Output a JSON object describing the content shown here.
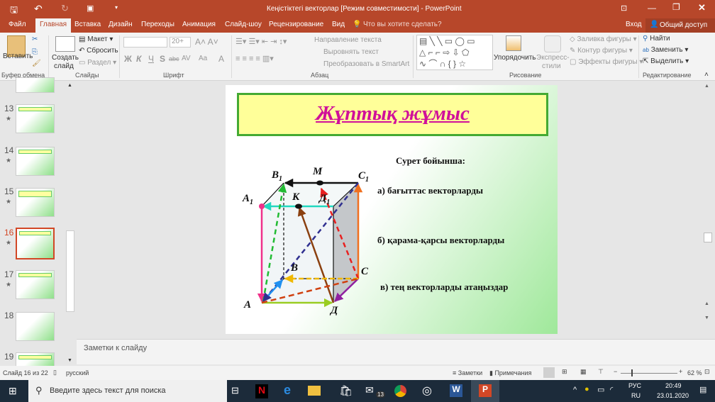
{
  "titlebar": {
    "title": "Кеңістіктегі векторлар [Режим совместимости] - PowerPoint",
    "signin": "Вход",
    "share": "Общий доступ"
  },
  "tabs": [
    "Файл",
    "Главная",
    "Вставка",
    "Дизайн",
    "Переходы",
    "Анимация",
    "Слайд-шоу",
    "Рецензирование",
    "Вид"
  ],
  "tell_me": "Что вы хотите сделать?",
  "ribbon": {
    "paste": "Вставить",
    "clipboard": "Буфер обмена",
    "new_slide_1": "Создать",
    "new_slide_2": "слайд",
    "layout": "Макет",
    "reset": "Сбросить",
    "section": "Раздел",
    "slides": "Слайды",
    "font_size": "20+",
    "font": "Шрифт",
    "bold": "Ж",
    "italic": "К",
    "underline": "Ч",
    "shadow": "S",
    "strike": "abc",
    "spacing": "AV",
    "case": "Aa",
    "font_color": "A",
    "text_dir": "Направление текста",
    "align_text": "Выровнять текст",
    "smartart": "Преобразовать в SmartArt",
    "paragraph": "Абзац",
    "arrange": "Упорядочить",
    "quick_styles_1": "Экспресс-",
    "quick_styles_2": "стили",
    "fill": "Заливка фигуры",
    "outline": "Контур фигуры",
    "effects": "Эффекты фигуры",
    "drawing": "Рисование",
    "find": "Найти",
    "replace": "Заменить",
    "select": "Выделить",
    "editing": "Редактирование"
  },
  "thumbnails": [
    {
      "num": "13"
    },
    {
      "num": "14"
    },
    {
      "num": "15"
    },
    {
      "num": "16",
      "current": true
    },
    {
      "num": "17"
    },
    {
      "num": "18"
    },
    {
      "num": "19"
    }
  ],
  "slide": {
    "title": "Жұптық жұмыс",
    "heading": "Сурет бойынша:",
    "item_a": "а) бағыттас векторларды",
    "item_b": "б) қарама-қарсы векторларды",
    "item_c": "в) тең векторларды атаңыздар",
    "labels": {
      "A": "A",
      "D": "Д",
      "C": "C",
      "B": "B",
      "A1": "A",
      "D1": "Д",
      "C1": "C",
      "B1": "B",
      "sub": "1",
      "K": "К",
      "M": "М"
    }
  },
  "notes": "Заметки к слайду",
  "status": {
    "slide": "Слайд 16 из 22",
    "lang": "русский",
    "notes": "Заметки",
    "comments": "Примечания",
    "zoom": "62 %",
    "zoom_value": 62
  },
  "taskbar": {
    "search": "Введите здесь текст для поиска",
    "lang1": "РУС",
    "lang2": "RU",
    "time": "20:49",
    "date": "23.01.2020",
    "mail_badge": "13"
  },
  "colors": {
    "accent": "#b7472a",
    "title": "#d0109a"
  }
}
